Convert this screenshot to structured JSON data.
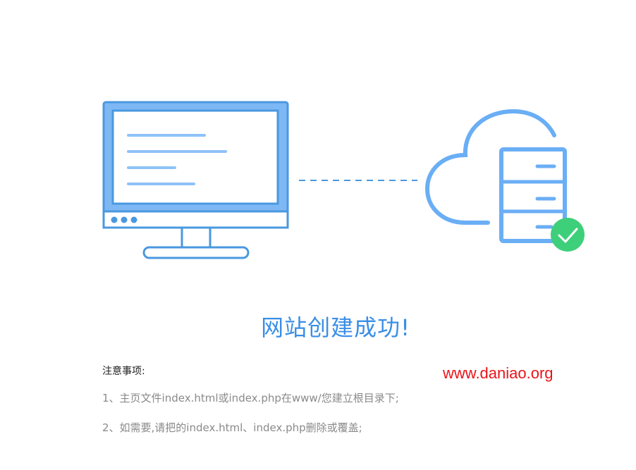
{
  "title": "网站创建成功!",
  "notes": {
    "heading": "注意事项:",
    "items": [
      "1、主页文件index.html或index.php在www/您建立根目录下;",
      "2、如需要,请把的index.html、index.php删除或覆盖;"
    ]
  },
  "watermark": "www.daniao.org",
  "colors": {
    "accent": "#3a8ee6",
    "monitor_frame": "#4a98e0",
    "monitor_screen_fill": "#7db8f5",
    "cloud": "#6aaef5",
    "check": "#3ecf7a",
    "watermark": "#e8141a"
  }
}
